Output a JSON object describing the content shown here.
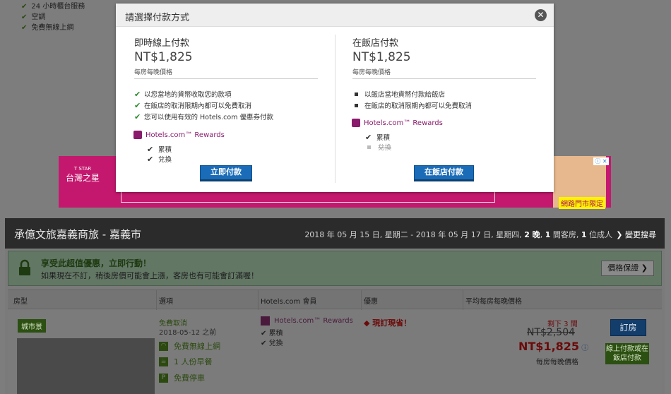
{
  "amenities": [
    "24 小時櫃台服務",
    "空調",
    "免費無線上網"
  ],
  "ad": {
    "brand_top": "T STAR",
    "brand": "台灣之星",
    "tag": "網路門市限定",
    "info": "ⓘ ✕"
  },
  "hotel": {
    "title": "承億文旅嘉義商旅 - 嘉義市",
    "dates_prefix": "2018 年 05 月 15 日, 星期二 - 2018 年 05 月 17 日, 星期四, ",
    "nights": "2 晚",
    "dates_mid": ", ",
    "rooms": "1",
    "dates_mid2": " 間客房, ",
    "adults": "1",
    "dates_suffix": " 位成人",
    "change": "❯ 變更搜尋"
  },
  "deal": {
    "title": "享受此超值優惠，立即行動！",
    "subtitle": "如果現在不訂，稍後房價可能會上漲，客房也有可能會訂滿喔！",
    "guarantee": "價格保證 ❯"
  },
  "table": {
    "headers": [
      "房型",
      "選項",
      "Hotels.com 會員",
      "優惠",
      "平均每房每晚價格"
    ]
  },
  "room": {
    "badge": "城市景",
    "free_cancel": "免費取消",
    "cancel_date": "2018-05-12 之前",
    "features": [
      "免費無線上網",
      "1 人份早餐",
      "免費停車"
    ],
    "rewards_label": "Hotels.com™ Rewards",
    "rewards_items": [
      "累積",
      "兌換"
    ],
    "promo": "現訂現省！",
    "left": "剩下 3 間",
    "old_price": "NT$2,504",
    "new_price": "NT$1,825",
    "per_night": "每房每晚價格",
    "book": "訂房",
    "book_note": "線上付款或在飯店付款"
  },
  "modal": {
    "title": "請選擇付款方式",
    "online": {
      "heading": "即時線上付款",
      "price": "NT$1,825",
      "per_night": "每房每晚價格",
      "items": [
        "以您當地的貨幣收取您的款項",
        "在飯店的取消限期內都可以免費取消",
        "您可以使用有效的 Hotels.com 優惠券付款"
      ],
      "rewards": "Hotels.com™ Rewards",
      "rewards_items": [
        "累積",
        "兌換"
      ],
      "button": "立即付款"
    },
    "hotel": {
      "heading": "在飯店付款",
      "price": "NT$1,825",
      "per_night": "每房每晚價格",
      "items": [
        "以飯店當地貨幣付款給飯店",
        "在飯店的取消限期內都可以免費取消"
      ],
      "rewards": "Hotels.com™ Rewards",
      "rewards_items": [
        "累積",
        "兌換"
      ],
      "button": "在飯店付款"
    }
  }
}
